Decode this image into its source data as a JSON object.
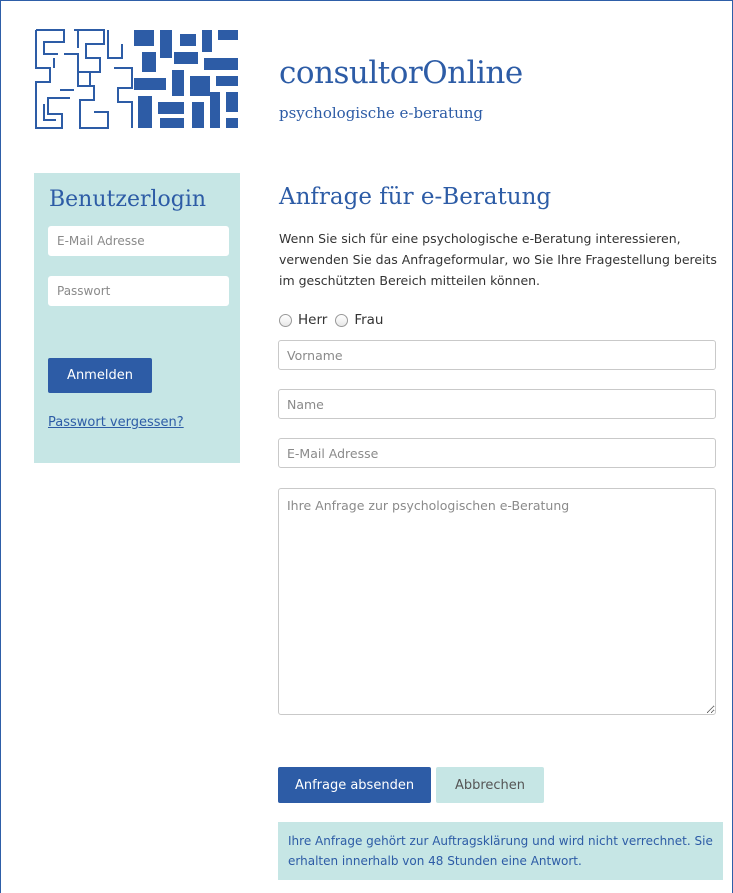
{
  "brand": {
    "title": "consultorOnline",
    "subtitle": "psychologische e-beratung",
    "logo": "maze-logo"
  },
  "login": {
    "heading": "Benutzerlogin",
    "email_placeholder": "E-Mail Adresse",
    "password_placeholder": "Passwort",
    "submit_label": "Anmelden",
    "forgot_label": "Passwort vergessen?"
  },
  "request": {
    "title": "Anfrage für e-Beratung",
    "intro": "Wenn Sie sich für eine psychologische e-Beratung interessieren, verwenden Sie das Anfrageformular, wo Sie Ihre Fragestellung bereits im geschützten Bereich mitteilen können.",
    "salutation": {
      "herr": "Herr",
      "frau": "Frau"
    },
    "firstname_placeholder": "Vorname",
    "name_placeholder": "Name",
    "email_placeholder": "E-Mail Adresse",
    "message_placeholder": "Ihre Anfrage zur psychologischen e-Beratung",
    "send_label": "Anfrage absenden",
    "cancel_label": "Abbrechen",
    "notice": "Ihre Anfrage gehört zur Auftragsklärung und wird nicht verrechnet. Sie erhalten innerhalb von 48 Stunden eine Antwort."
  },
  "colors": {
    "brand_blue": "#2d5ca6",
    "panel_teal": "#c6e6e5"
  }
}
